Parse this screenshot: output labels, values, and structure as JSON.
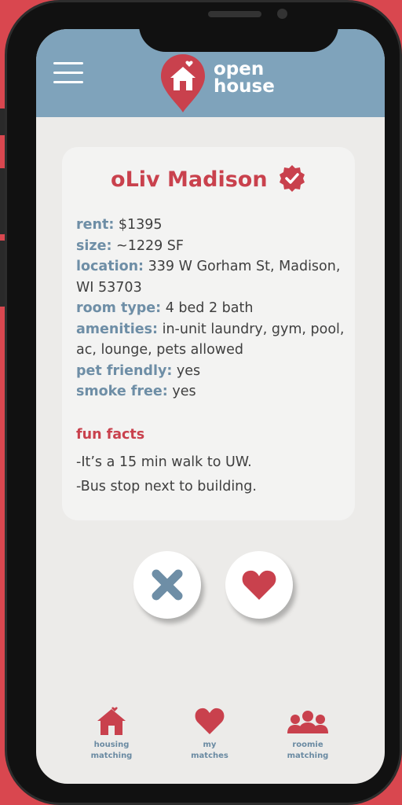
{
  "header": {
    "logo_line1": "open",
    "logo_line2": "house"
  },
  "listing": {
    "name": "oLiv Madison",
    "details": [
      {
        "label": "rent:",
        "value": " $1395"
      },
      {
        "label": "size:",
        "value": " ~1229 SF"
      },
      {
        "label": "location:",
        "value": " 339 W Gorham St, Madison, WI 53703"
      },
      {
        "label": "room type:",
        "value": " 4 bed 2 bath"
      },
      {
        "label": "amenities:",
        "value": " in-unit laundry, gym, pool, ac, lounge, pets allowed"
      },
      {
        "label": "pet friendly:",
        "value": " yes"
      },
      {
        "label": "smoke free:",
        "value": " yes"
      }
    ],
    "fun_facts_title": "fun facts",
    "fun_facts": [
      "-It’s a 15 min walk to UW.",
      "-Bus stop next to building."
    ]
  },
  "nav": {
    "items": [
      {
        "label": "housing\nmatching",
        "icon": "house-icon"
      },
      {
        "label": "my\nmatches",
        "icon": "heart-icon"
      },
      {
        "label": "roomie\nmatching",
        "icon": "people-icon"
      }
    ]
  },
  "colors": {
    "accent_red": "#c9414d",
    "header_blue": "#7fa3bb",
    "label_blue": "#6e8ea6"
  }
}
